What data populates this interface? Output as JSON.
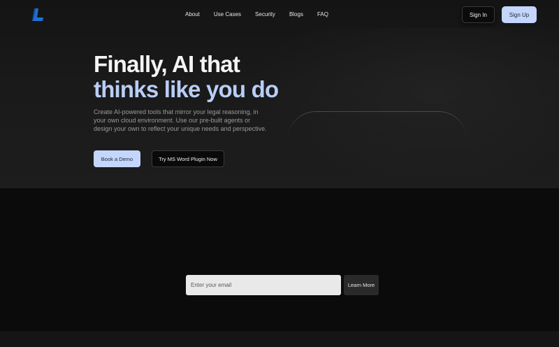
{
  "nav": {
    "logo_icon": "l-logo-icon",
    "links": [
      {
        "label": "About"
      },
      {
        "label": "Use Cases"
      },
      {
        "label": "Security"
      },
      {
        "label": "Blogs"
      },
      {
        "label": "FAQ"
      }
    ],
    "sign_in_label": "Sign In",
    "sign_up_label": "Sign Up"
  },
  "hero": {
    "headline_line1": "Finally, AI that",
    "headline_line2": "thinks like you do",
    "subtitle": "Create AI-powered tools that mirror your legal reasoning, in your own cloud environment. Use our pre-built agents or design your own to reflect your unique needs and perspective.",
    "primary_cta": "Book a Demo",
    "secondary_cta": "Try MS Word Plugin Now"
  },
  "newsletter": {
    "email_placeholder": "Enter your email",
    "button_label": "Learn More"
  },
  "colors": {
    "accent": "#c4d6fb",
    "headline_accent": "#b9cdf6",
    "logo_blue": "#1f6fd1"
  }
}
